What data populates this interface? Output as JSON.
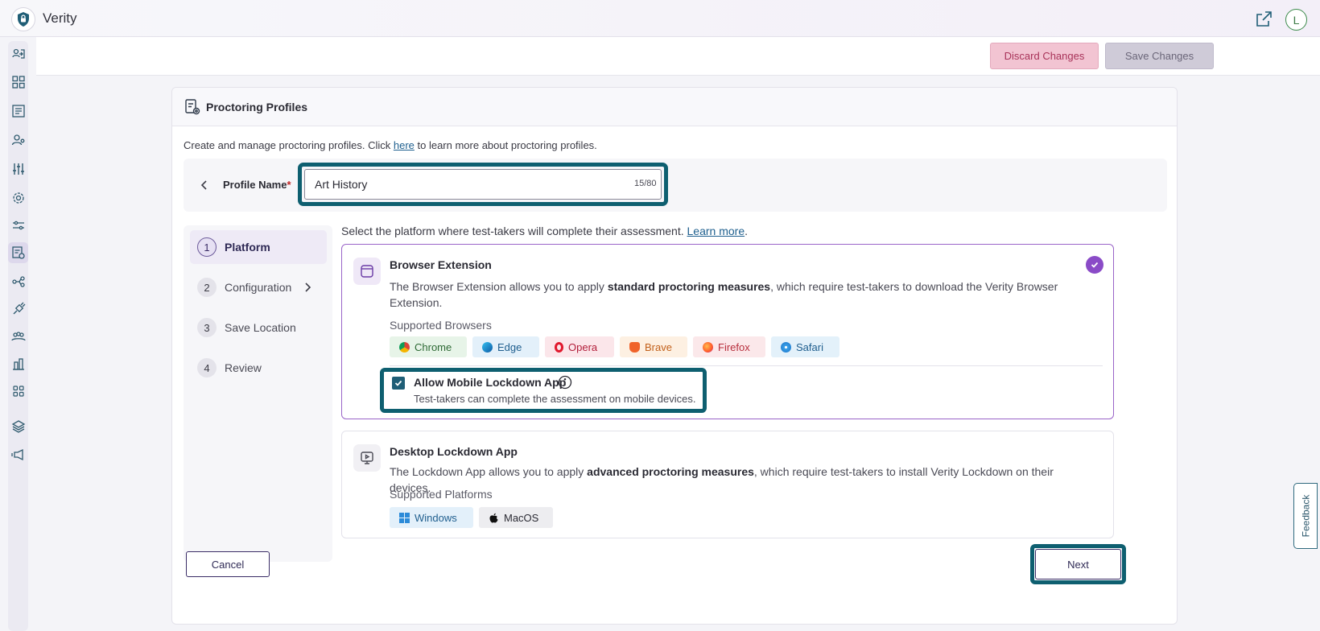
{
  "app": {
    "title": "Verity",
    "avatar_initial": "L"
  },
  "actions": {
    "discard_label": "Discard Changes",
    "save_label": "Save Changes"
  },
  "card": {
    "title": "Proctoring Profiles",
    "intro_before": "Create and manage proctoring profiles. Click ",
    "intro_link": "here",
    "intro_after": " to learn more about proctoring profiles."
  },
  "profile": {
    "label": "Profile Name",
    "required_mark": "*",
    "value": "Art History",
    "counter": "15/80"
  },
  "steps": [
    {
      "num": "1",
      "label": "Platform"
    },
    {
      "num": "2",
      "label": "Configuration"
    },
    {
      "num": "3",
      "label": "Save Location"
    },
    {
      "num": "4",
      "label": "Review"
    }
  ],
  "platform": {
    "intro_before": "Select the platform where test-takers will complete their assessment. ",
    "intro_link": "Learn more",
    "intro_after": ".",
    "browser": {
      "title": "Browser Extension",
      "desc_before": "The Browser Extension allows you to apply ",
      "desc_bold": "standard proctoring measures",
      "desc_after": ", which require test-takers to download the Verity Browser Extension.",
      "supported_label": "Supported Browsers",
      "browsers": [
        "Chrome",
        "Edge",
        "Opera",
        "Brave",
        "Firefox",
        "Safari"
      ],
      "mobile_title": "Allow Mobile Lockdown App",
      "mobile_desc": "Test-takers can complete the assessment on mobile devices."
    },
    "desktop": {
      "title": "Desktop Lockdown App",
      "desc_before": "The Lockdown App allows you to apply ",
      "desc_bold": "advanced proctoring measures",
      "desc_after": ", which require test-takers to install Verity Lockdown on their devices.",
      "supported_label": "Supported Platforms",
      "platforms": [
        "Windows",
        "MacOS"
      ]
    }
  },
  "buttons": {
    "cancel": "Cancel",
    "next": "Next"
  },
  "feedback": "Feedback",
  "colors": {
    "accent": "#8a4bc7",
    "highlight": "#0e5f70",
    "primary_text": "#2f2a55"
  }
}
